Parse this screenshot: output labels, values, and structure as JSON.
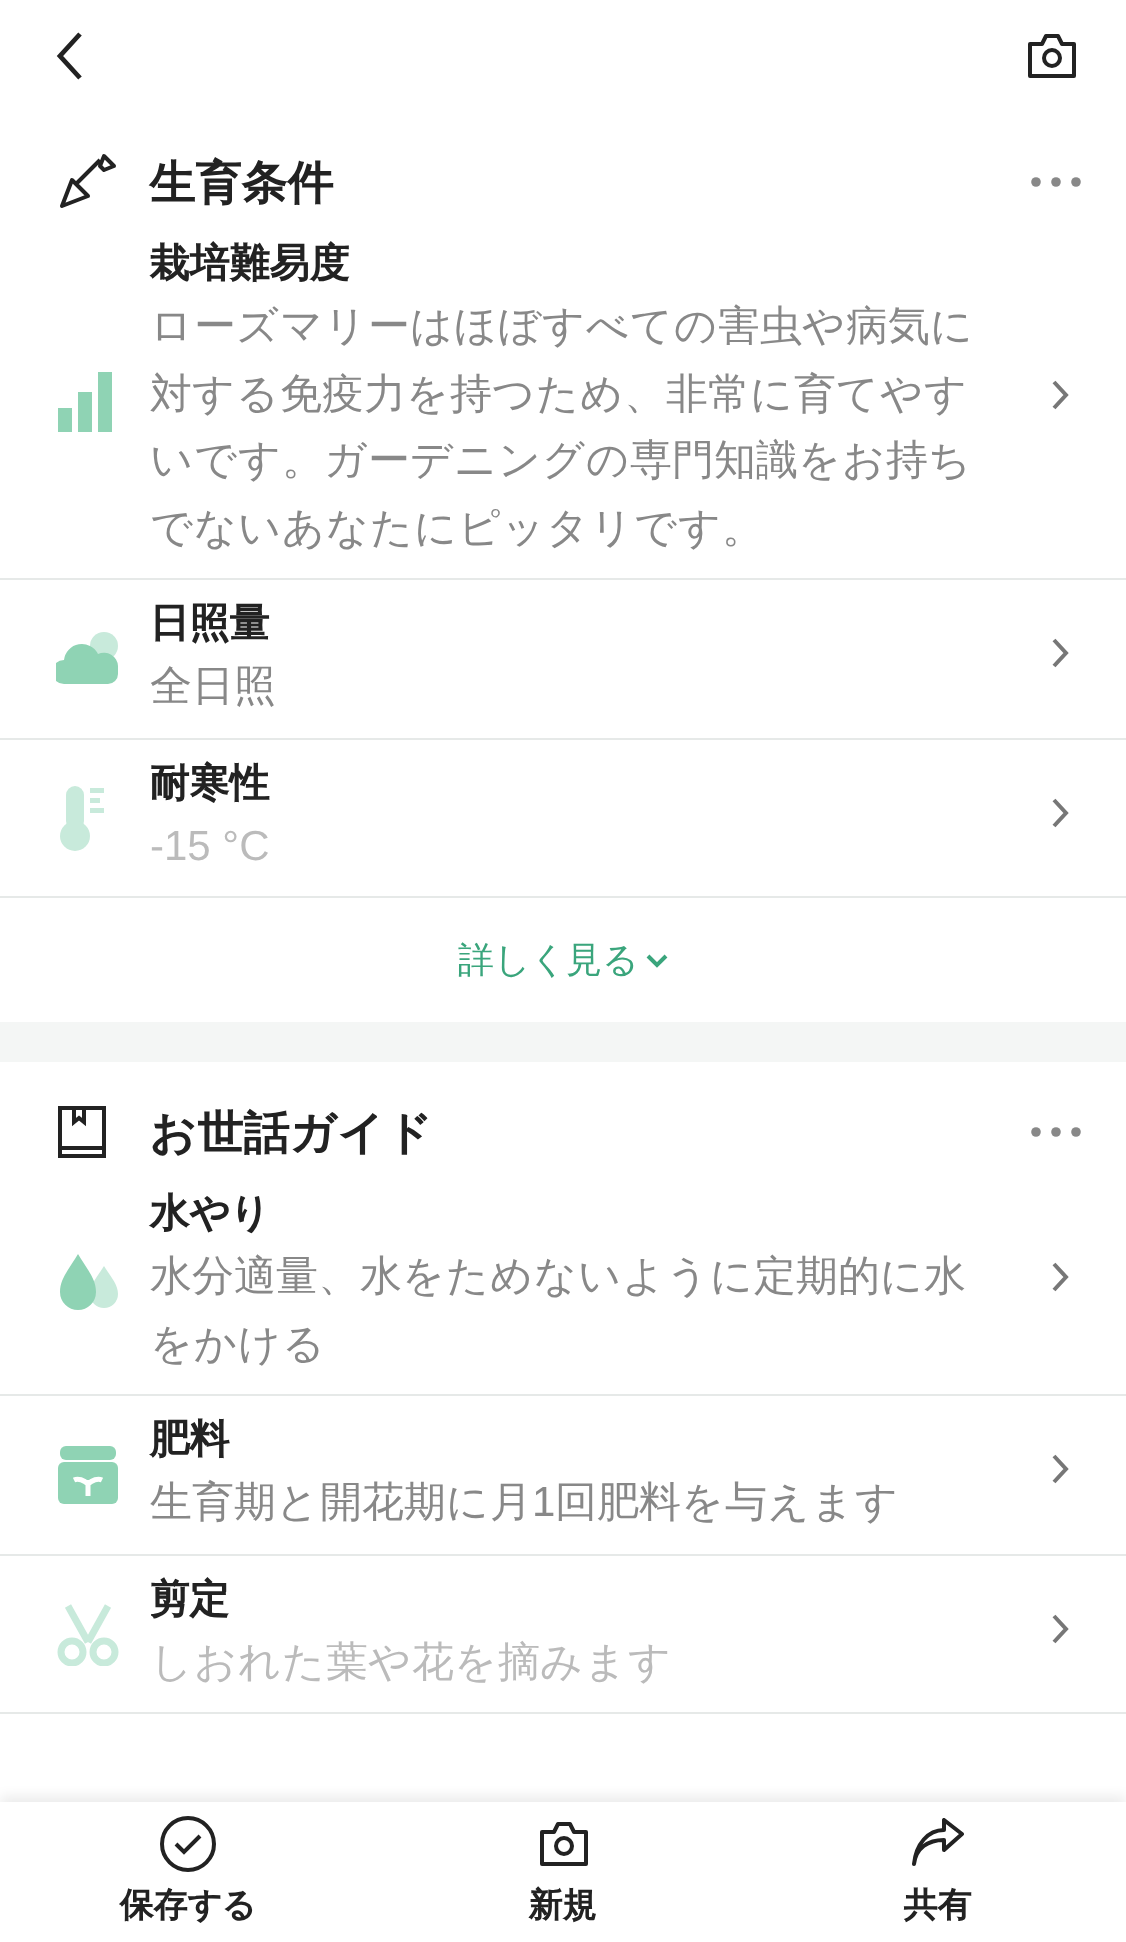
{
  "sections": [
    {
      "title": "生育条件",
      "kind": "conditions",
      "rows": [
        {
          "kind": "difficulty",
          "title": "栽培難易度",
          "description": "ローズマリーはほぼすべての害虫や病気に対する免疫力を持つため、非常に育てやすいです。ガーデニングの専門知識をお持ちでないあなたにピッタリです。",
          "faded": false
        },
        {
          "kind": "light",
          "title": "日照量",
          "description": "全日照",
          "faded": false
        },
        {
          "kind": "temperature",
          "title": "耐寒性",
          "description": "-15 °C",
          "faded": true
        }
      ],
      "more_link": "詳しく見る"
    },
    {
      "title": "お世話ガイド",
      "kind": "guide",
      "rows": [
        {
          "kind": "water",
          "title": "水やり",
          "description": "水分適量、水をためないように定期的に水をかける",
          "faded": false
        },
        {
          "kind": "fertilizer",
          "title": "肥料",
          "description": "生育期と開花期に月1回肥料を与えます",
          "faded": false
        },
        {
          "kind": "pruning",
          "title": "剪定",
          "description": "しおれた葉や花を摘みます",
          "faded": true
        }
      ]
    }
  ],
  "bottom_bar": [
    {
      "kind": "save",
      "label": "保存する"
    },
    {
      "kind": "new",
      "label": "新規"
    },
    {
      "kind": "share",
      "label": "共有"
    }
  ]
}
